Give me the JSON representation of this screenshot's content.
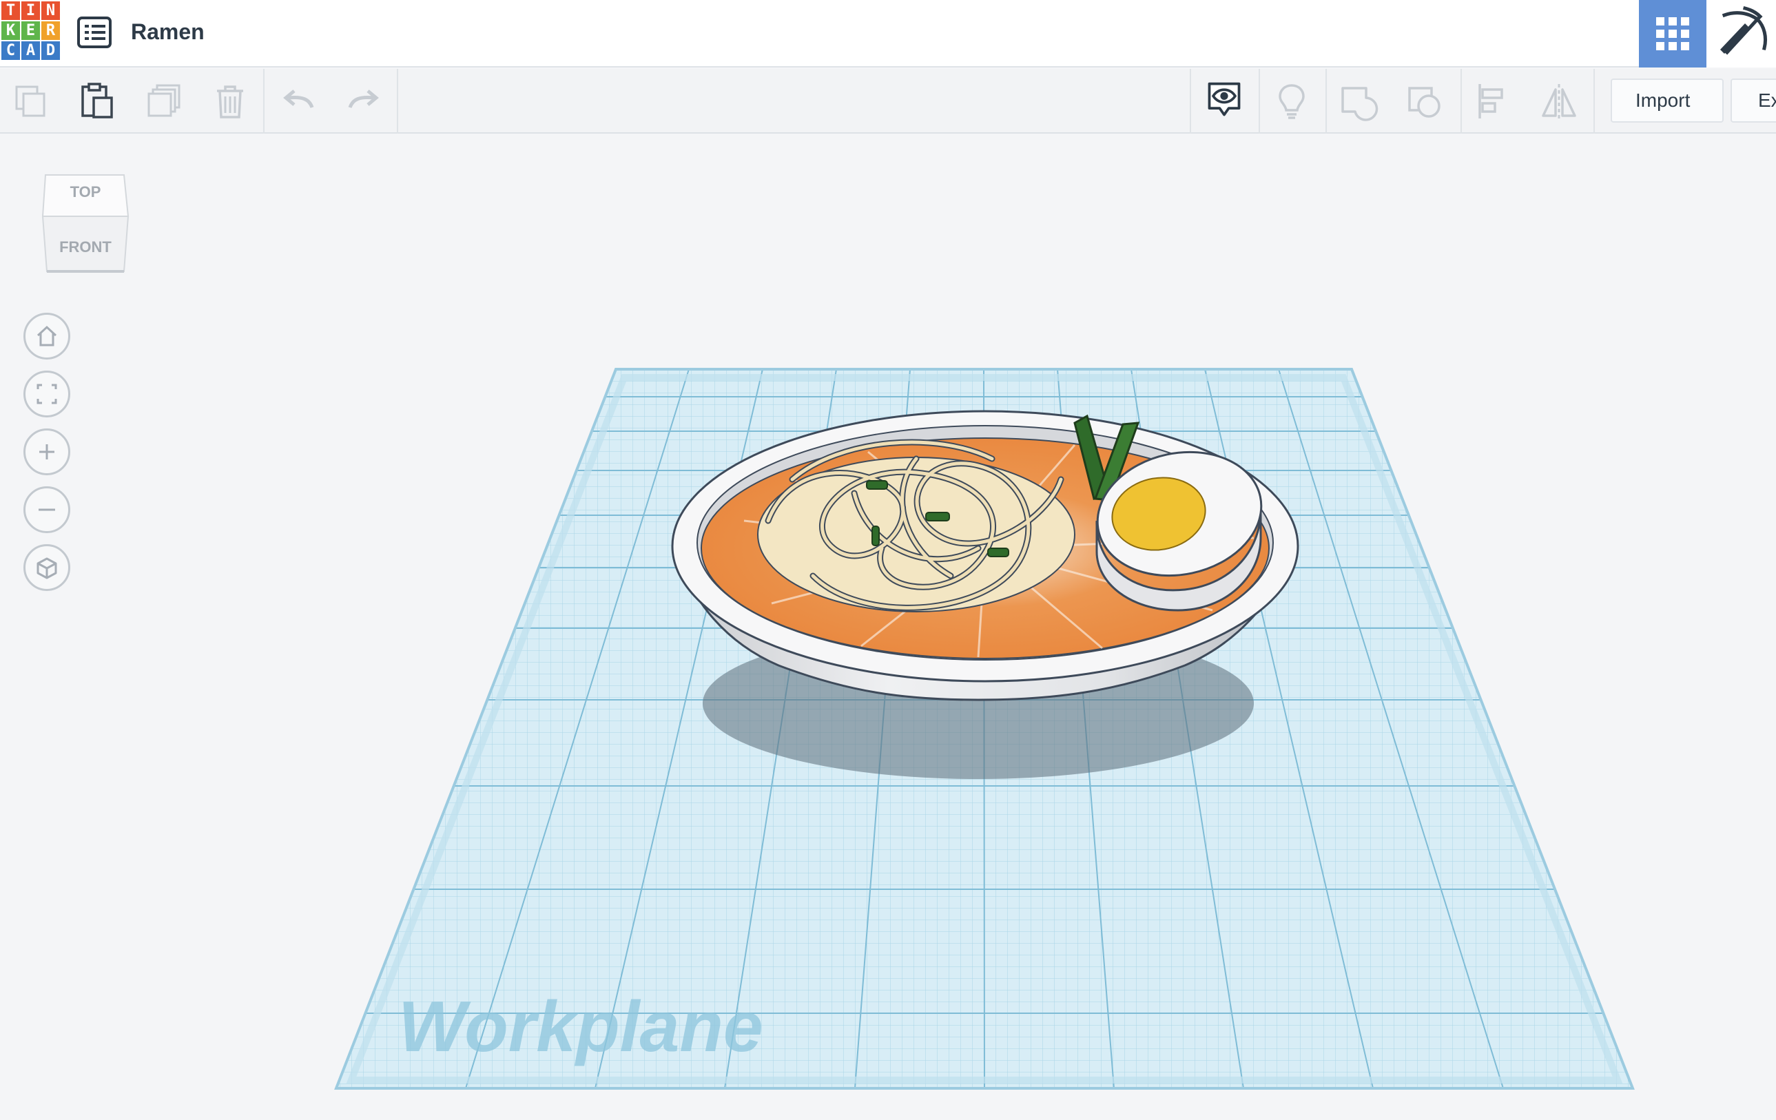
{
  "app": {
    "logo_letters": [
      "T",
      "I",
      "N",
      "K",
      "E",
      "R",
      "C",
      "A",
      "D"
    ],
    "logo_colors": [
      "#e8522f",
      "#e8522f",
      "#e8522f",
      "#5fb54b",
      "#5fb54b",
      "#f0a12a",
      "#3b7bc7",
      "#3b7bc7",
      "#3b7bc7"
    ],
    "title": "Ramen"
  },
  "header": {
    "menu_icon": "design-list-icon",
    "view_buttons": [
      {
        "icon": "grid-view-icon",
        "active": true,
        "color": "#5f8fd6"
      },
      {
        "icon": "pickaxe-icon",
        "active": false
      }
    ]
  },
  "toolbar": {
    "edit_tools": [
      {
        "icon": "copy-icon"
      },
      {
        "icon": "paste-icon"
      },
      {
        "icon": "duplicate-icon"
      },
      {
        "icon": "delete-icon"
      }
    ],
    "history_tools": [
      {
        "icon": "undo-icon"
      },
      {
        "icon": "redo-icon"
      }
    ],
    "view_tools": [
      {
        "icon": "show-all-icon"
      },
      {
        "icon": "notes-icon"
      },
      {
        "icon": "group-icon"
      },
      {
        "icon": "ungroup-icon"
      },
      {
        "icon": "align-icon"
      },
      {
        "icon": "mirror-icon"
      }
    ],
    "import_label": "Import",
    "export_label": "Ex"
  },
  "navcube": {
    "top_label": "TOP",
    "front_label": "FRONT"
  },
  "view_controls": [
    {
      "name": "home-view",
      "icon": "home-icon"
    },
    {
      "name": "fit-all",
      "icon": "fit-view-icon"
    },
    {
      "name": "zoom-in",
      "icon": "plus-icon"
    },
    {
      "name": "zoom-out",
      "icon": "minus-icon"
    },
    {
      "name": "ortho-toggle",
      "icon": "perspective-cube-icon"
    }
  ],
  "workplane": {
    "label": "Workplane"
  }
}
